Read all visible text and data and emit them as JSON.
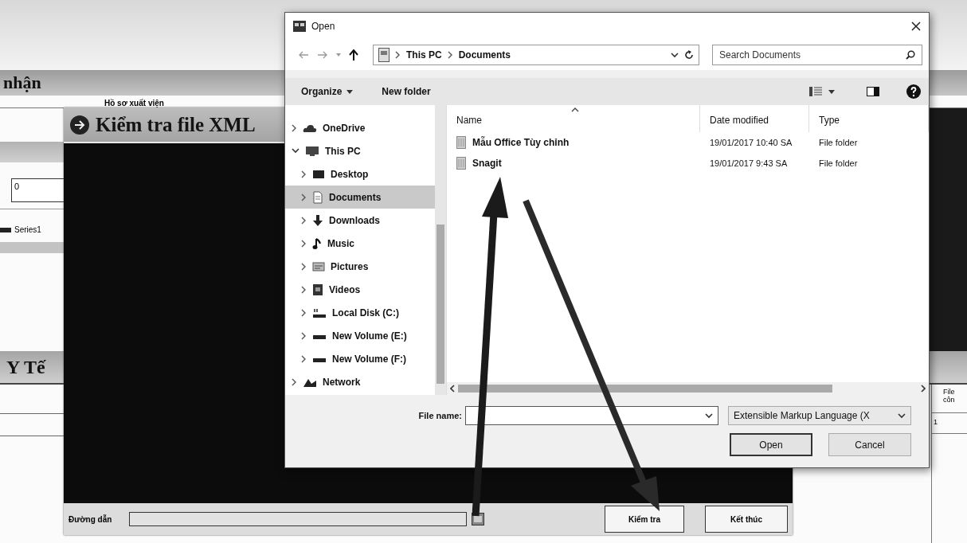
{
  "background_app": {
    "title": "nhận",
    "group_label": "Hồ sơ xuất viện",
    "field_value": "0",
    "legend_label": "Series1",
    "section_title": "Y Tế",
    "column_header": "File côn",
    "cell": "1"
  },
  "xml_window": {
    "title": "Kiểm tra file XML",
    "path_label": "Đường dẫn",
    "buttons": [
      "Kiểm tra",
      "Kết thúc"
    ]
  },
  "open_dialog": {
    "title": "Open",
    "breadcrumb": [
      "This PC",
      "Documents"
    ],
    "search": {
      "placeholder": "Search Documents"
    },
    "toolbar": [
      "Organize",
      "New folder"
    ],
    "nav": [
      {
        "label": "OneDrive",
        "expanded": false,
        "selected": false
      },
      {
        "label": "This PC",
        "expanded": true,
        "selected": false,
        "children": [
          {
            "label": "Desktop",
            "expanded": false,
            "selected": false
          },
          {
            "label": "Documents",
            "expanded": false,
            "selected": true
          },
          {
            "label": "Downloads",
            "expanded": false,
            "selected": false
          },
          {
            "label": "Music",
            "expanded": false,
            "selected": false
          },
          {
            "label": "Pictures",
            "expanded": false,
            "selected": false
          },
          {
            "label": "Videos",
            "expanded": false,
            "selected": false
          },
          {
            "label": "Local Disk (C:)",
            "expanded": false,
            "selected": false
          },
          {
            "label": "New Volume (E:)",
            "expanded": false,
            "selected": false
          },
          {
            "label": "New Volume (F:)",
            "expanded": false,
            "selected": false
          }
        ]
      },
      {
        "label": "Network",
        "expanded": false,
        "selected": false
      }
    ],
    "columns": [
      "Name",
      "Date modified",
      "Type"
    ],
    "files": [
      {
        "name": "Mẫu Office Tùy chỉnh",
        "date": "19/01/2017 10:40 SA",
        "type": "File folder"
      },
      {
        "name": "Snagit",
        "date": "19/01/2017 9:43 SA",
        "type": "File folder"
      }
    ],
    "file_name_label": "File name:",
    "file_type": "Extensible Markup Language (X",
    "buttons": [
      {
        "label": "Open",
        "default": true
      },
      {
        "label": "Cancel",
        "default": false
      }
    ]
  }
}
